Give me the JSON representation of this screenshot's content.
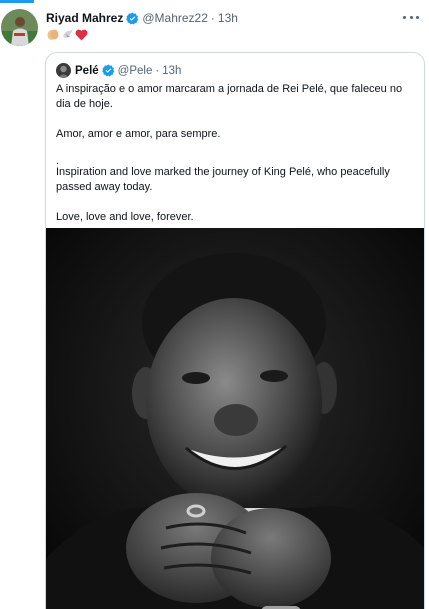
{
  "tweet": {
    "author_name": "Riyad Mahrez",
    "author_handle": "@Mahrez22",
    "separator": "·",
    "time": "13h",
    "emojis": [
      "clapping-hands-icon",
      "dove-icon",
      "red-heart-icon"
    ]
  },
  "quoted": {
    "author_name": "Pelé",
    "author_handle": "@Pele",
    "separator": "·",
    "time": "13h",
    "text_pt": "A inspiração e o amor marcaram a jornada de Rei Pelé, que faleceu no dia de hoje.",
    "text_pt_2": "Amor, amor e amor, para sempre.",
    "text_dot": ".",
    "text_en": "Inspiration and love marked the journey of King Pelé, who peacefully passed away today.",
    "text_en_2": "Love, love and love, forever."
  },
  "colors": {
    "verified_blue": "#1d9bf0",
    "secondary_text": "#536471",
    "border": "#cfd9de"
  }
}
